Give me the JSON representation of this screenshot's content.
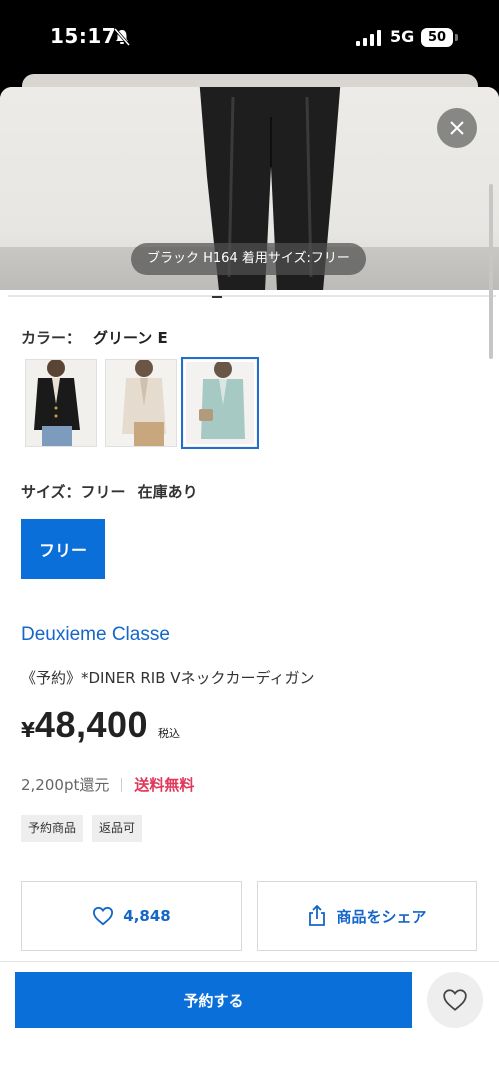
{
  "status_bar": {
    "time": "15:17",
    "network": "5G",
    "battery": "50"
  },
  "hero": {
    "caption": "ブラック H164 着用サイズ:フリー",
    "close_icon": "close-icon"
  },
  "color": {
    "label": "カラー：",
    "value": "グリーン E",
    "swatches": [
      "black-cardigan",
      "beige-cardigan",
      "green-cardigan"
    ],
    "selected_index": 2
  },
  "size": {
    "label": "サイズ：フリー",
    "stock": "在庫あり",
    "options": [
      "フリー"
    ]
  },
  "product": {
    "brand": "Deuxieme Classe",
    "name": "《予約》*DINER RIB Vネックカーディガン",
    "price_yen": "¥",
    "price_amount": "48,400",
    "tax_label": "税込",
    "points": "2,200pt還元",
    "free_shipping": "送料無料",
    "tags": [
      "予約商品",
      "返品可"
    ]
  },
  "actions": {
    "favorite_count": "4,848",
    "share_label": "商品をシェア",
    "reserve_label": "予約する"
  },
  "colors": {
    "accent": "#0b6fd9",
    "link": "#1466c8",
    "highlight": "#e0385a"
  }
}
